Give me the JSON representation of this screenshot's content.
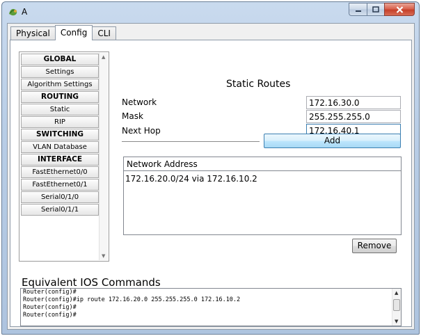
{
  "window": {
    "title": "A"
  },
  "tabs": [
    {
      "label": "Physical"
    },
    {
      "label": "Config"
    },
    {
      "label": "CLI"
    }
  ],
  "sidebar": {
    "items": [
      {
        "label": "GLOBAL",
        "header": true
      },
      {
        "label": "Settings",
        "header": false
      },
      {
        "label": "Algorithm Settings",
        "header": false
      },
      {
        "label": "ROUTING",
        "header": true
      },
      {
        "label": "Static",
        "header": false
      },
      {
        "label": "RIP",
        "header": false
      },
      {
        "label": "SWITCHING",
        "header": true
      },
      {
        "label": "VLAN Database",
        "header": false
      },
      {
        "label": "INTERFACE",
        "header": true
      },
      {
        "label": "FastEthernet0/0",
        "header": false
      },
      {
        "label": "FastEthernet0/1",
        "header": false
      },
      {
        "label": "Serial0/1/0",
        "header": false
      },
      {
        "label": "Serial0/1/1",
        "header": false
      }
    ]
  },
  "static_routes": {
    "title": "Static Routes",
    "network_label": "Network",
    "network_value": "172.16.30.0",
    "mask_label": "Mask",
    "mask_value": "255.255.255.0",
    "next_hop_label": "Next Hop",
    "next_hop_value": "172.16.40.1",
    "add_label": "Add",
    "list_header": "Network Address",
    "routes": [
      "172.16.20.0/24 via 172.16.10.2"
    ],
    "remove_label": "Remove"
  },
  "ios": {
    "title": "Equivalent IOS Commands",
    "lines": [
      "Router(config)#",
      "Router(config)#ip route 172.16.20.0 255.255.255.0 172.16.10.2",
      "Router(config)#",
      "Router(config)#"
    ]
  },
  "colors": {
    "accent_button": "#bee6fd",
    "titlebar": "#b8cde6",
    "close_button": "#c6402a"
  }
}
